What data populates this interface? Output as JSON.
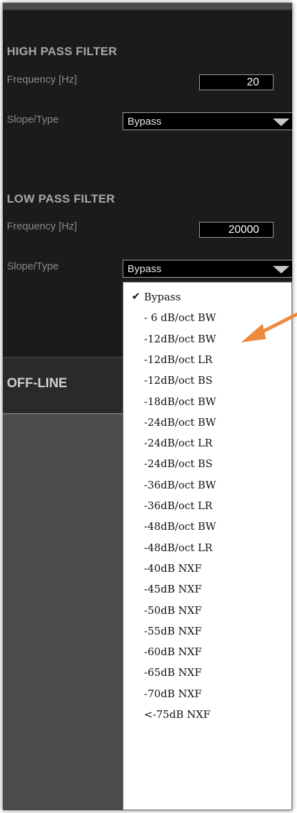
{
  "high_pass": {
    "title": "HIGH PASS FILTER",
    "frequency_label": "Frequency [Hz]",
    "frequency_value": "20",
    "slope_label": "Slope/Type",
    "slope_value": "Bypass"
  },
  "low_pass": {
    "title": "LOW PASS FILTER",
    "frequency_label": "Frequency [Hz]",
    "frequency_value": "20000",
    "slope_label": "Slope/Type",
    "slope_value": "Bypass"
  },
  "status": {
    "label": "OFF-LINE"
  },
  "dropdown": {
    "checked_index": 0,
    "options": [
      "Bypass",
      "- 6 dB/oct BW",
      "-12dB/oct BW",
      "-12dB/oct LR",
      "-12dB/oct BS",
      "-18dB/oct BW",
      "-24dB/oct BW",
      "-24dB/oct LR",
      "-24dB/oct BS",
      "-36dB/oct BW",
      "-36dB/oct LR",
      "-48dB/oct BW",
      "-48dB/oct LR",
      "-40dB NXF",
      "-45dB NXF",
      "-50dB NXF",
      "-55dB NXF",
      "-60dB NXF",
      "-65dB NXF",
      "-70dB NXF",
      "<-75dB NXF"
    ]
  },
  "colors": {
    "accent_orange": "#e59a2e",
    "panel_bg": "#1b1b1b",
    "lower_bg": "#4b4b4b"
  }
}
